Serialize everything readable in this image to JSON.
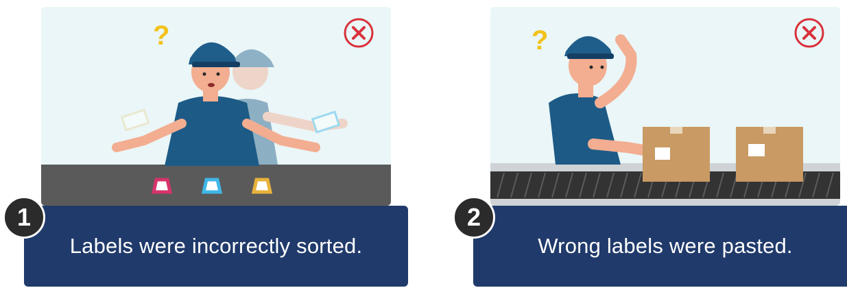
{
  "scenes": [
    {
      "number": "1",
      "caption": "Labels were incorrectly sorted.",
      "label_colors": [
        "#d6336c",
        "#3fb7e6",
        "#e8b23a"
      ]
    },
    {
      "number": "2",
      "caption": "Wrong labels were pasted."
    }
  ],
  "colors": {
    "panel_bg": "#eaf6f7",
    "caption_bg": "#203a6b",
    "badge_bg": "#2b2b2b",
    "error_mark": "#d9303a",
    "question_mark": "#f2c21b",
    "shirt": "#1d5b86",
    "cap": "#1f5d8a",
    "skin": "#f3ad90",
    "box": "#c99a63",
    "conveyor": "#5a5a5a"
  },
  "icons": [
    "question-mark-icon",
    "error-x-icon"
  ]
}
